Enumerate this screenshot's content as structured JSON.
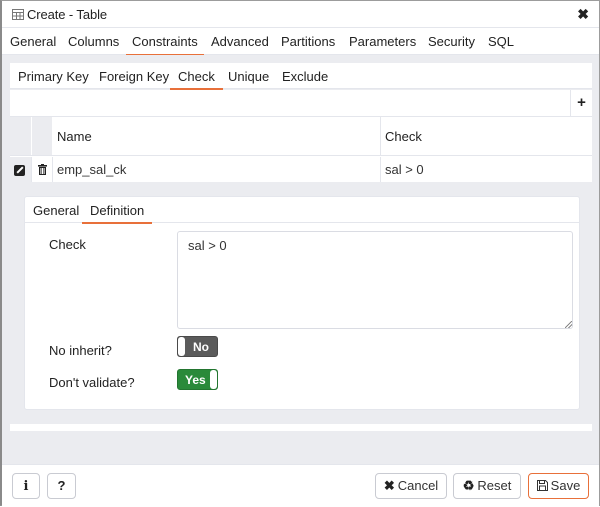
{
  "dialog": {
    "title": "Create - Table",
    "title_icon": "table-icon",
    "close_icon": "close-icon"
  },
  "tabs": [
    {
      "label": "General",
      "active": false
    },
    {
      "label": "Columns",
      "active": false
    },
    {
      "label": "Constraints",
      "active": true
    },
    {
      "label": "Advanced",
      "active": false
    },
    {
      "label": "Partitions",
      "active": false
    },
    {
      "label": "Parameters",
      "active": false
    },
    {
      "label": "Security",
      "active": false
    },
    {
      "label": "SQL",
      "active": false
    }
  ],
  "constraint_tabs": [
    {
      "label": "Primary Key",
      "active": false
    },
    {
      "label": "Foreign Key",
      "active": false
    },
    {
      "label": "Check",
      "active": true
    },
    {
      "label": "Unique",
      "active": false
    },
    {
      "label": "Exclude",
      "active": false
    }
  ],
  "grid": {
    "add_label": "+",
    "columns": [
      "Name",
      "Check"
    ],
    "rows": [
      {
        "name": "emp_sal_ck",
        "check": "sal > 0"
      }
    ]
  },
  "definition": {
    "tabs": [
      {
        "label": "General",
        "active": false
      },
      {
        "label": "Definition",
        "active": true
      }
    ],
    "check_label": "Check",
    "check_value": "sal > 0",
    "no_inherit_label": "No inherit?",
    "no_inherit_value": "No",
    "dont_validate_label": "Don't validate?",
    "dont_validate_value": "Yes"
  },
  "footer": {
    "info_label": "i",
    "help_label": "?",
    "cancel_label": "Cancel",
    "reset_label": "Reset",
    "save_label": "Save"
  },
  "colors": {
    "accent": "#e8703a",
    "toggle_on": "#2a8a3a",
    "toggle_off": "#5b5b5b",
    "panel_bg": "#ebecf0"
  }
}
